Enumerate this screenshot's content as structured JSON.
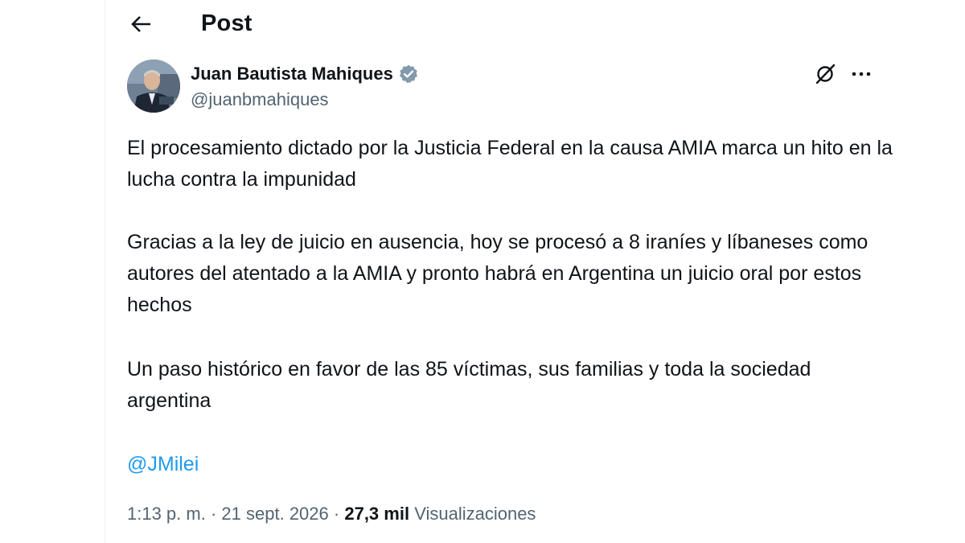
{
  "header": {
    "title": "Post"
  },
  "tweet": {
    "author": {
      "name": "Juan Bautista Mahiques",
      "handle": "@juanbmahiques",
      "verified": true
    },
    "paragraphs": [
      "El procesamiento dictado por la Justicia Federal en la causa AMIA marca un hito en la lucha contra la impunidad",
      "Gracias a la ley de juicio en ausencia, hoy se procesó a 8 iraníes y líbaneses como autores del atentado a la AMIA y pronto habrá en Argentina un juicio oral por estos hechos",
      "Un paso histórico en favor de las 85 víctimas, sus familias y toda la sociedad argentina"
    ],
    "mention": "@JMilei",
    "time": "1:13 p. m.",
    "separator": "·",
    "date": "21 sept. 2026",
    "views_count": "27,3 mil",
    "views_label": "Visualizaciones"
  },
  "icons": {
    "back": "arrow-left-icon",
    "verified": "verified-badge-icon",
    "grok": "grok-icon",
    "more": "more-horizontal-icon"
  },
  "colors": {
    "text_primary": "#0f1419",
    "text_secondary": "#536471",
    "link": "#1d9bf0",
    "verified_badge": "#829aab"
  }
}
